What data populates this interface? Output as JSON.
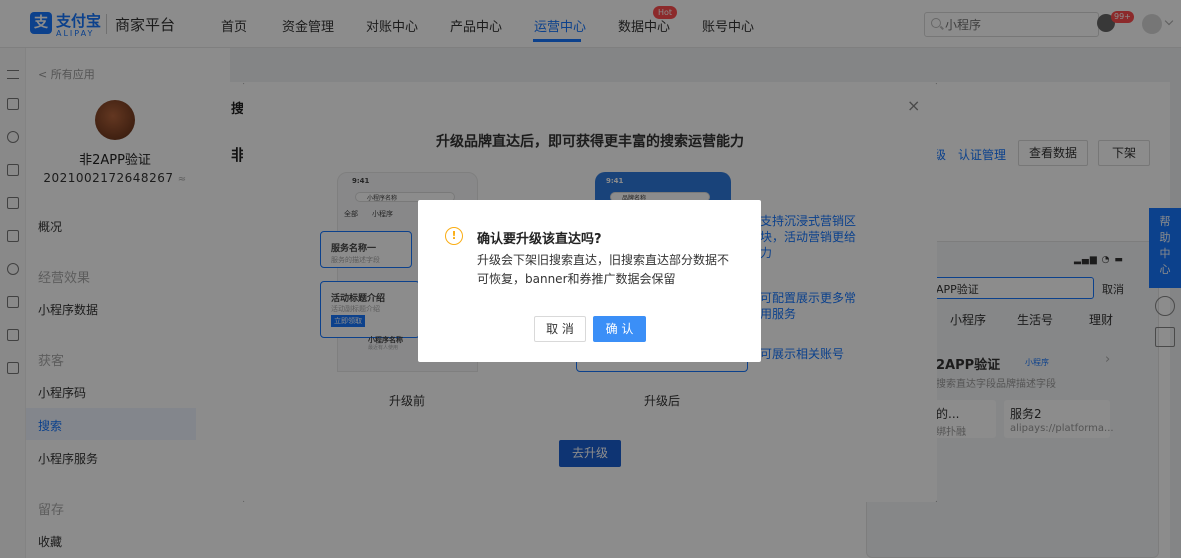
{
  "header": {
    "brand_cn": "支付宝",
    "brand_en": "ALIPAY",
    "portal": "商家平台",
    "nav": [
      {
        "label": "首页"
      },
      {
        "label": "资金管理"
      },
      {
        "label": "对账中心"
      },
      {
        "label": "产品中心"
      },
      {
        "label": "运营中心",
        "active": true
      },
      {
        "label": "数据中心",
        "badge": "Hot"
      },
      {
        "label": "账号中心"
      }
    ],
    "search_placeholder": "小程序",
    "message_badge": "99+"
  },
  "sidebar": {
    "back": "< 所有应用",
    "app_name": "非2APP验证",
    "app_id": "2021002172648267",
    "items": [
      {
        "type": "item",
        "label": "概况"
      },
      {
        "type": "group",
        "label": "经营效果"
      },
      {
        "type": "item",
        "label": "小程序数据"
      },
      {
        "type": "group",
        "label": "获客"
      },
      {
        "type": "item",
        "label": "小程序码"
      },
      {
        "type": "item",
        "label": "搜索",
        "active": true
      },
      {
        "type": "item",
        "label": "小程序服务"
      },
      {
        "type": "group",
        "label": "留存"
      },
      {
        "type": "item",
        "label": "收藏"
      }
    ]
  },
  "main": {
    "title_1": "搜",
    "title_2": "非",
    "links": [
      "级",
      "认证管理"
    ],
    "buttons": [
      "查看数据",
      "下架"
    ],
    "preview": {
      "search_value": "APP验证",
      "cancel": "取消",
      "tabs": [
        "小程序",
        "生活号",
        "理财"
      ],
      "result_name": "2APP验证",
      "result_tag": "小程序",
      "result_desc": "搜索直达字段品牌描述字段",
      "svc1_title": "的...",
      "svc1_sub": "绑扑融",
      "svc2_title": "服务2",
      "svc2_sub": "alipays://platforma..."
    },
    "help": [
      "帮",
      "助",
      "中",
      "心"
    ]
  },
  "upgrade_modal": {
    "close": "×",
    "title": "升级品牌直达后，即可获得更丰富的搜索运营能力",
    "before_caption": "升级前",
    "after_caption": "升级后",
    "before_phone": {
      "time": "9:41",
      "search": "小程序名称",
      "tabs": [
        "全部",
        "小程序"
      ],
      "svc_title": "服务名称一",
      "svc_desc": "服务的描述字段",
      "act_title": "活动标题介绍",
      "act_desc": "活动副标题介绍",
      "act_btn": "立即领取",
      "item_title": "小程序名称",
      "item_desc": "最近有人使用"
    },
    "after_phone": {
      "time": "9:41",
      "search": "品牌名称"
    },
    "features": [
      [
        "支持沉浸式营销区",
        "块，活动营销更给",
        "力"
      ],
      [
        "可配置展示更多常",
        "用服务"
      ],
      [
        "可展示相关账号"
      ]
    ],
    "upgrade_button": "去升级"
  },
  "confirm_dialog": {
    "icon": "!",
    "title": "确认要升级该直达吗?",
    "body": "升级会下架旧搜索直达，旧搜索直达部分数据不可恢复，banner和券推广数据会保留",
    "cancel": "取 消",
    "ok": "确 认"
  }
}
